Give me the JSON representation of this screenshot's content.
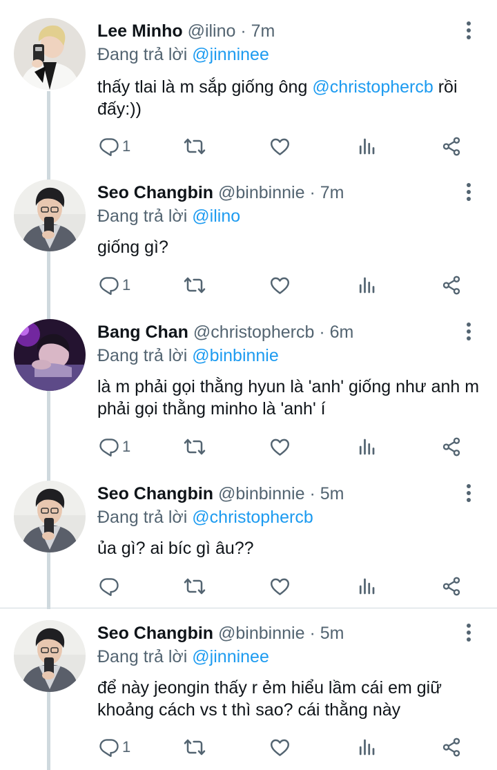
{
  "colors": {
    "accent": "#1d9bf0",
    "text": "#0f1419",
    "secondary": "#536471",
    "line": "#cfd9de"
  },
  "tweets": [
    {
      "name": "Lee Minho",
      "handle": "@ilino",
      "separator": "·",
      "time": "7m",
      "replying_label": "Đang trả lời",
      "replying_to": "@jinninee",
      "body_text": "thấy tlai là m sắp giống ông ",
      "body_mention": "@christophercb",
      "body_tail": " rồi đấy:))",
      "reply_count": "1",
      "avatar_icon": "profile-photo"
    },
    {
      "name": "Seo Changbin",
      "handle": "@binbinnie",
      "separator": "·",
      "time": "7m",
      "replying_label": "Đang trả lời",
      "replying_to": "@ilino",
      "body_text": "giống gì?",
      "reply_count": "1",
      "avatar_icon": "profile-photo"
    },
    {
      "name": "Bang Chan",
      "handle": "@christophercb",
      "separator": "·",
      "time": "6m",
      "replying_label": "Đang trả lời",
      "replying_to": "@binbinnie",
      "body_text": "là m phải gọi thằng hyun là 'anh' giống như anh m phải gọi thằng minho là 'anh' í",
      "reply_count": "1",
      "avatar_icon": "profile-photo"
    },
    {
      "name": "Seo Changbin",
      "handle": "@binbinnie",
      "separator": "·",
      "time": "5m",
      "replying_label": "Đang trả lời",
      "replying_to": "@christophercb",
      "body_text": "ủa gì? ai bíc gì âu??",
      "reply_count": "",
      "avatar_icon": "profile-photo"
    },
    {
      "name": "Seo Changbin",
      "handle": "@binbinnie",
      "separator": "·",
      "time": "5m",
      "replying_label": "Đang trả lời",
      "replying_to": "@jinninee",
      "body_text": "để này jeongin thấy r ẻm hiểu lầm cái em giữ khoảng cách vs t thì sao? cái thằng này",
      "reply_count": "1",
      "avatar_icon": "profile-photo"
    }
  ]
}
